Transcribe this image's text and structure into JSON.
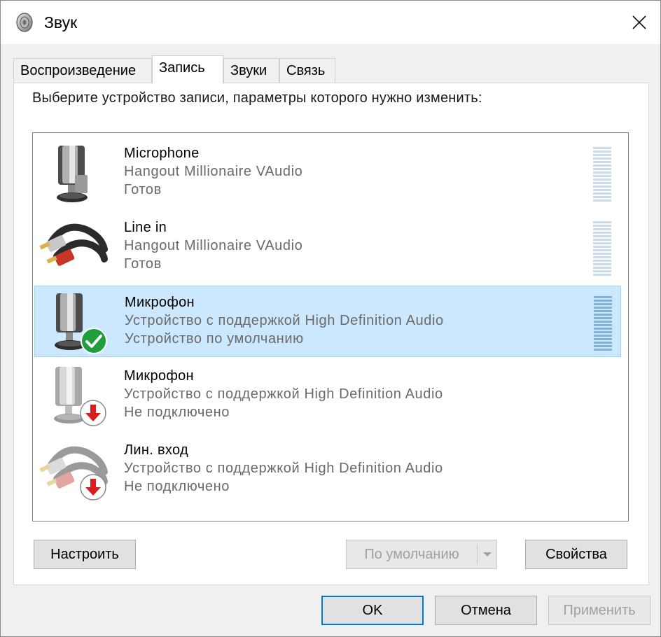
{
  "window": {
    "title": "Звук",
    "close_glyph": "✕"
  },
  "tabs": [
    {
      "label": "Воспроизведение",
      "active": false
    },
    {
      "label": "Запись",
      "active": true
    },
    {
      "label": "Звуки",
      "active": false
    },
    {
      "label": "Связь",
      "active": false
    }
  ],
  "instruction": "Выберите устройство записи, параметры которого нужно изменить:",
  "devices": [
    {
      "name": "Microphone",
      "description": "Hangout Millionaire VAudio",
      "status": "Готов",
      "icon": "microphone-icon",
      "badge": "none",
      "selected": false
    },
    {
      "name": "Line in",
      "description": "Hangout Millionaire VAudio",
      "status": "Готов",
      "icon": "line-in-cable-icon",
      "badge": "none",
      "selected": false
    },
    {
      "name": "Микрофон",
      "description": "Устройство с поддержкой High Definition Audio",
      "status": "Устройство по умолчанию",
      "icon": "microphone-icon",
      "badge": "default-check",
      "selected": true
    },
    {
      "name": "Микрофон",
      "description": "Устройство с поддержкой High Definition Audio",
      "status": "Не подключено",
      "icon": "microphone-icon",
      "badge": "disconnected-arrow",
      "selected": false
    },
    {
      "name": "Лин. вход",
      "description": "Устройство с поддержкой High Definition Audio",
      "status": "Не подключено",
      "icon": "line-in-cable-icon",
      "badge": "disconnected-arrow",
      "selected": false
    }
  ],
  "buttons": {
    "configure": "Настроить",
    "set_default": "По умолчанию",
    "properties": "Свойства",
    "ok": "OK",
    "cancel": "Отмена",
    "apply": "Применить"
  },
  "colors": {
    "selection_bg": "#cce8ff",
    "selection_border": "#99d1ff",
    "default_button_border": "#0078d7",
    "check_green": "#1e9e3c",
    "arrow_red": "#d81e1e"
  }
}
